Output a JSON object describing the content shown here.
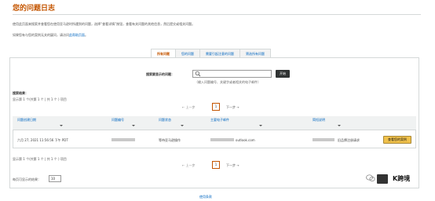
{
  "page": {
    "title": "您的问题日志",
    "intro_line1_a": "使用此页面来搜索并查看您在使用亚马逊时所遇到的问题，选择“查看详情”按钮，查看有关问题的其他信息，然后提交或相关问题。",
    "intro_line2_a": "如果您有与您的案例无关的疑问，请访问",
    "intro_line2_link": "此帮助页面",
    "intro_line2_b": "。"
  },
  "tabs": [
    {
      "label": "所有问题",
      "active": true
    },
    {
      "label": "您的问题",
      "active": false
    },
    {
      "label": "需要引起注意的问题",
      "active": false
    },
    {
      "label": "筛选所有问题",
      "active": false
    }
  ],
  "search": {
    "label": "搜索要显示的问题：",
    "value": "",
    "button": "开始",
    "hint": "（输入问题编号、关键字或者相关的电子邮件）"
  },
  "results": {
    "title": "搜索结果：",
    "showing_top": "显示第 1 个(共第 1 个 | 共 1 个 ) 项目",
    "showing_bottom": "显示第 1 个(共第 1 个 | 共 1 个 ) 项目"
  },
  "pagination": {
    "prev": "← 上一步",
    "page": "1",
    "next": "下一步 →"
  },
  "table": {
    "headers": [
      "问题创建日期",
      "问题编号",
      "问题状态",
      "主要电子邮件",
      "简短说明"
    ],
    "rows": [
      {
        "date": "六月 27, 2021 11:56:56 下午 PDT",
        "status": "等待亚马逊操作",
        "email": "outlook.com",
        "summary": "旧品牌注册请求",
        "action": "查看您的案例"
      }
    ]
  },
  "per_page": {
    "label": "每页可显示的结果：",
    "value": "10"
  },
  "footer": {
    "help": "使用条款"
  },
  "watermark": {
    "text": "K跨境"
  }
}
